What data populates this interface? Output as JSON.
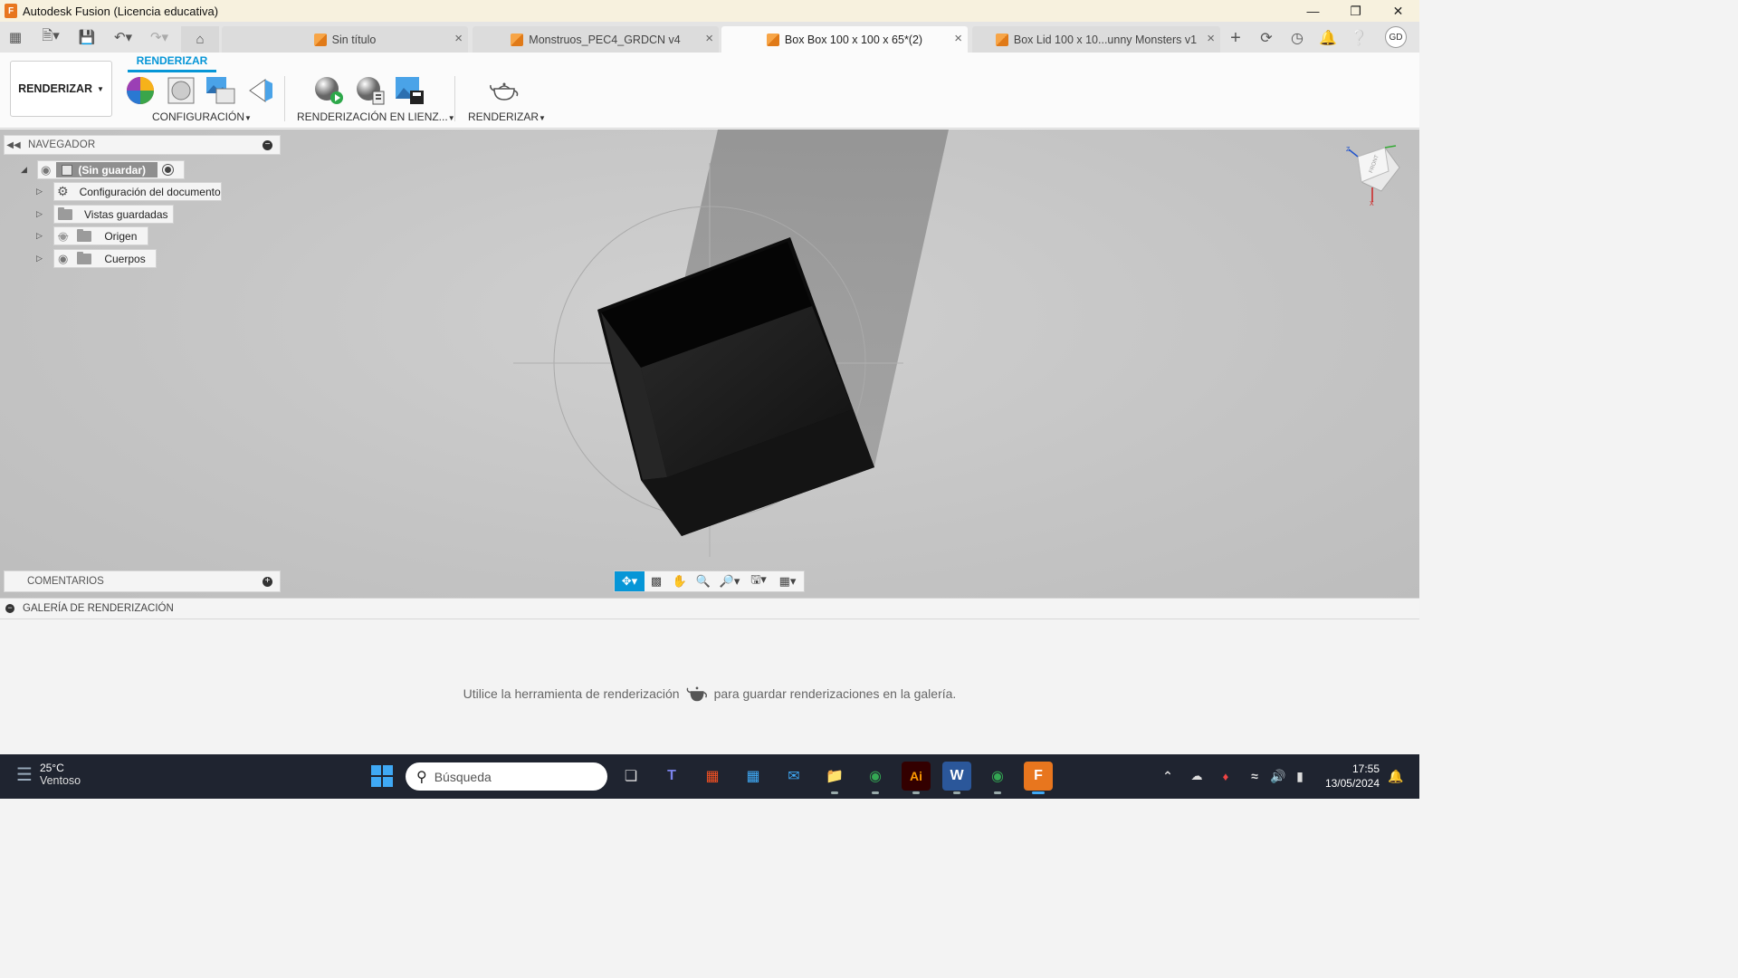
{
  "window": {
    "app_icon": "F",
    "title": "Autodesk Fusion (Licencia educativa)",
    "controls": [
      "minimize-icon",
      "restore-icon",
      "close-icon"
    ]
  },
  "tabs": [
    {
      "label": "Sin título",
      "active": false
    },
    {
      "label": "Monstruos_PEC4_GRDCN v4",
      "active": false
    },
    {
      "label": "Box Box 100 x 100 x 65*(2)",
      "active": true
    },
    {
      "label": "Box Lid 100 x 10...unny Monsters v1",
      "active": false
    }
  ],
  "user": {
    "initials": "GD"
  },
  "ribbon": {
    "workspace": "RENDERIZAR",
    "active_tab": "RENDERIZAR",
    "groups": {
      "configuracion": "CONFIGURACIÓN",
      "render_canvas": "RENDERIZACIÓN EN LIENZ...",
      "renderizar": "RENDERIZAR"
    }
  },
  "browser": {
    "title": "NAVEGADOR",
    "root": "(Sin guardar)",
    "items": [
      {
        "label": "Configuración del documento",
        "icon": "gear-icon"
      },
      {
        "label": "Vistas guardadas",
        "icon": "folder-icon"
      },
      {
        "label": "Origen",
        "icon": "folder-icon",
        "visibility": "hidden"
      },
      {
        "label": "Cuerpos",
        "icon": "folder-icon",
        "visibility": "visible"
      }
    ]
  },
  "comments": {
    "title": "COMENTARIOS"
  },
  "gallery": {
    "title": "GALERÍA DE RENDERIZACIÓN",
    "message_before": "Utilice la herramienta de renderización",
    "message_after": "para guardar renderizaciones en la galería."
  },
  "taskbar": {
    "temperature": "25°C",
    "condition": "Ventoso",
    "search_placeholder": "Búsqueda",
    "time": "17:55",
    "date": "13/05/2024"
  },
  "colors": {
    "accent": "#0696d7",
    "titlebar": "#f7f1de",
    "taskbar": "#1f2430",
    "fusion_orange": "#e8761e"
  }
}
